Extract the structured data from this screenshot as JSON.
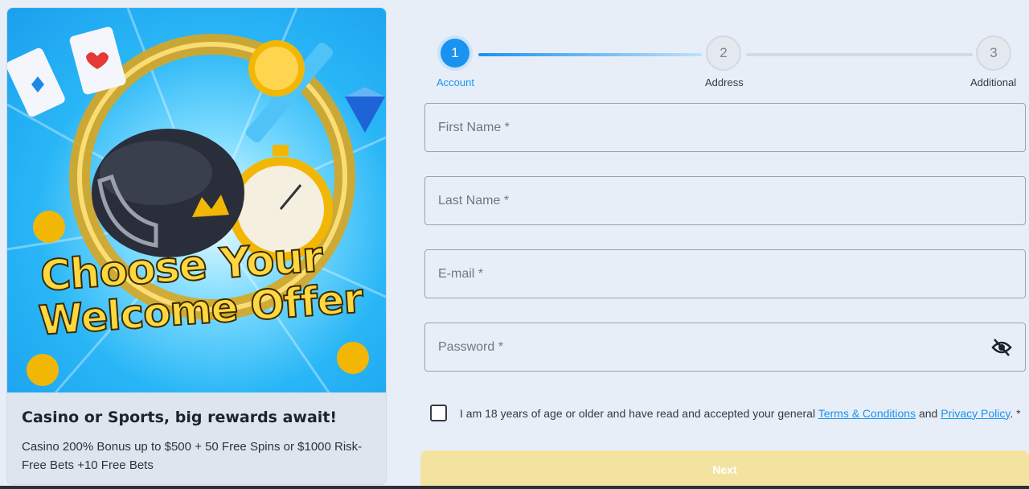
{
  "promo": {
    "headline_line1": "Choose Your",
    "headline_line2": "Welcome Offer",
    "title": "Casino or Sports, big rewards await!",
    "description": "Casino 200% Bonus up to $500 + 50 Free Spins or $1000 Risk-Free Bets +10 Free Bets"
  },
  "stepper": {
    "steps": [
      {
        "number": "1",
        "label": "Account",
        "state": "active"
      },
      {
        "number": "2",
        "label": "Address",
        "state": "idle"
      },
      {
        "number": "3",
        "label": "Additional",
        "state": "idle"
      }
    ]
  },
  "form": {
    "first_name_placeholder": "First Name *",
    "last_name_placeholder": "Last Name *",
    "email_placeholder": "E-mail *",
    "password_placeholder": "Password *",
    "terms_prefix": "I am 18 years of age or older and have read and accepted your general ",
    "terms_link": "Terms & Conditions",
    "terms_middle": " and ",
    "privacy_link": "Privacy Policy",
    "terms_suffix": ". *",
    "next_label": "Next"
  },
  "colors": {
    "accent": "#1a93f0",
    "next_button": "#f3e3a1",
    "background": "#e8eef7"
  },
  "icons": {
    "password_toggle": "eye-off-icon",
    "checkbox": "checkbox-unchecked"
  }
}
